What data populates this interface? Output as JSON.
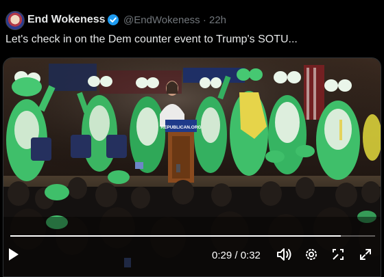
{
  "tweet": {
    "author_name": "End Wokeness",
    "handle_and_time": "@EndWokeness · 22h",
    "text": "Let's check in on the Dem counter event to Trump's SOTU..."
  },
  "video": {
    "podium_sign": "REPUBLICAN.ORG",
    "time_display": "0:29 / 0:32",
    "progress": 0.906
  },
  "icons": {
    "play": "play-icon",
    "volume": "volume-icon",
    "settings": "gear-icon",
    "expand": "expand-icon",
    "fullscreen": "fullscreen-icon",
    "verified": "verified-badge-icon"
  },
  "colors": {
    "verified_blue": "#1d9bf0",
    "frog_green": "#3fbf6a",
    "background": "#000000"
  }
}
